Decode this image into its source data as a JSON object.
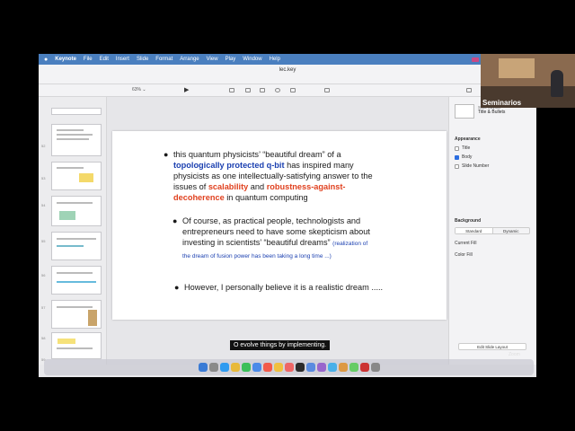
{
  "menubar": {
    "app": "Keynote",
    "items": [
      "File",
      "Edit",
      "Insert",
      "Slide",
      "Format",
      "Arrange",
      "View",
      "Play",
      "Window",
      "Help"
    ]
  },
  "window": {
    "title": "lec.key",
    "zoom": "63% ⌄"
  },
  "slide": {
    "bullet1": {
      "t1": "this quantum physicists’ “beautiful dream” of a",
      "t2": "topologically protected q-bit",
      "t3": " has inspired many",
      "t4": "physicists as one intellectually-satisfying answer to the",
      "t5": "issues of ",
      "t6": "scalability",
      "t7": " and ",
      "t8": "robustness-against-",
      "t9": "decoherence",
      "t10": " in quantum computing"
    },
    "bullet2": {
      "t1": "Of course, as practical people, technologists and",
      "t2": "entrepreneurs need to have some skepticism about",
      "t3": "investing in scientists’ “beautiful dreams”",
      "t4": "(realization of",
      "t5": "the dream of fusion power has been  taking a long time ...)"
    },
    "bullet3": "However, I personally believe it is a realistic dream ....."
  },
  "navigator": {
    "slide_numbers": [
      "52",
      "53",
      "54",
      "55",
      "56",
      "57",
      "58",
      "59",
      "60"
    ]
  },
  "inspector": {
    "layout_label": "Slide Layout",
    "layout_name": "Title & Bullets",
    "appearance": "Appearance",
    "title": "Title",
    "body": "Body",
    "slide_number": "Slide Number",
    "background": "Background",
    "standard": "Standard",
    "dynamic": "Dynamic",
    "current_fill": "Current Fill",
    "color_fill": "Color Fill",
    "edit_layout": "Edit Slide Layout"
  },
  "caption": "O evolve things by implementing.",
  "webcam": {
    "name": "Seminarios"
  },
  "zoom_label": "Zoom",
  "colors": {
    "accent_blue": "#1a3fb0",
    "accent_red": "#e0411f",
    "menubar": "#4a7fbf"
  }
}
